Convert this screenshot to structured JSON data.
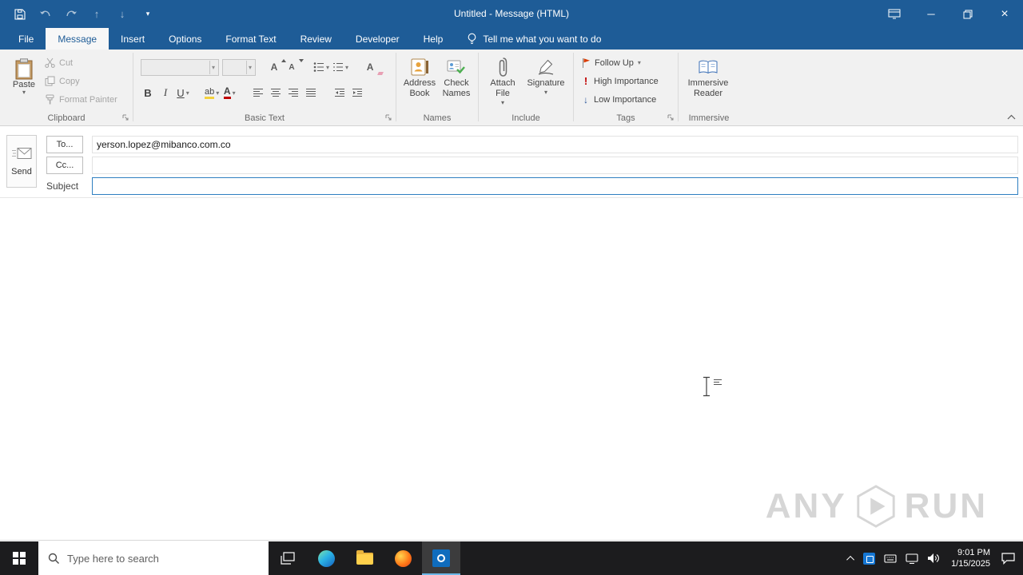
{
  "colors": {
    "titlebar_blue": "#1e5c97",
    "ribbon_bg": "#f1f1f1",
    "flag_red": "#d83b01",
    "high_importance_red": "#c00000",
    "low_importance_blue": "#2b579a",
    "subject_focus_blue": "#2f7fc1",
    "taskbar_bg": "#1c1c1e",
    "outlook_tile_blue": "#0f6cbd"
  },
  "titlebar": {
    "title": "Untitled - Message (HTML)"
  },
  "tabs": {
    "items": [
      {
        "label": "File"
      },
      {
        "label": "Message"
      },
      {
        "label": "Insert"
      },
      {
        "label": "Options"
      },
      {
        "label": "Format Text"
      },
      {
        "label": "Review"
      },
      {
        "label": "Developer"
      },
      {
        "label": "Help"
      }
    ],
    "tell_me": "Tell me what you want to do"
  },
  "ribbon": {
    "clipboard": {
      "group_label": "Clipboard",
      "paste": "Paste",
      "cut": "Cut",
      "copy": "Copy",
      "format_painter": "Format Painter"
    },
    "basic_text": {
      "group_label": "Basic Text"
    },
    "names": {
      "group_label": "Names",
      "address_book_line1": "Address",
      "address_book_line2": "Book",
      "check_names_line1": "Check",
      "check_names_line2": "Names"
    },
    "include": {
      "group_label": "Include",
      "attach_line1": "Attach",
      "attach_line2": "File",
      "signature": "Signature"
    },
    "tags": {
      "group_label": "Tags",
      "follow_up": "Follow Up",
      "high_importance": "High Importance",
      "low_importance": "Low Importance"
    },
    "immersive": {
      "group_label": "Immersive",
      "reader_line1": "Immersive",
      "reader_line2": "Reader"
    }
  },
  "glyphs": {
    "dropdown": "▾",
    "bold": "B",
    "italic": "I",
    "underline": "U",
    "grow_font": "A",
    "shrink_font": "A",
    "clear_format": "A",
    "highlight": "ab",
    "font_color": "A",
    "high_importance": "!",
    "low_importance": "↓",
    "minimize": "─",
    "close": "×",
    "prev_item": "↑",
    "next_item": "↓"
  },
  "compose": {
    "send_label": "Send",
    "to_label": "To...",
    "to_value": "yerson.lopez@mibanco.com.co",
    "cc_label": "Cc...",
    "cc_value": "",
    "subject_label": "Subject",
    "subject_value": ""
  },
  "watermark": {
    "any": "ANY",
    "run": "RUN"
  },
  "taskbar": {
    "search_placeholder": "Type here to search",
    "clock_time": "9:01 PM",
    "clock_date": "1/15/2025"
  }
}
